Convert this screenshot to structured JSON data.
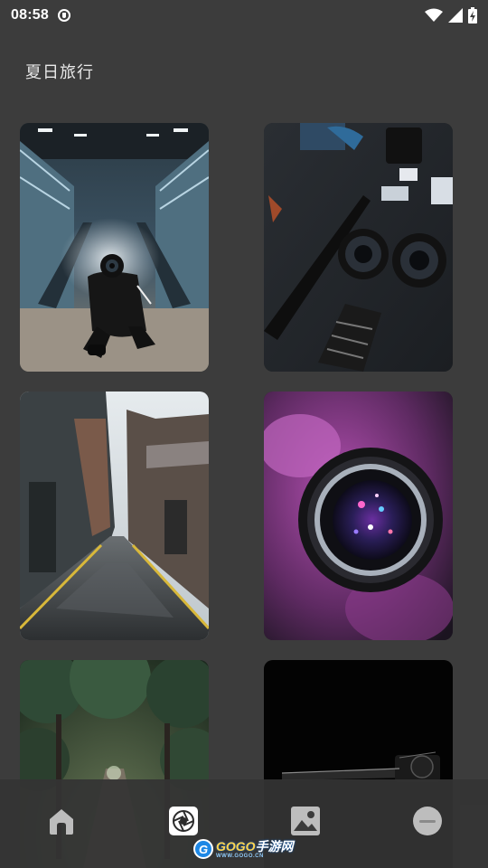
{
  "status_bar": {
    "time": "08:58",
    "icons": [
      "shield-icon",
      "wifi-icon",
      "signal-icon",
      "battery-icon"
    ]
  },
  "album": {
    "title": "夏日旅行"
  },
  "photos": [
    {
      "subject": "escalator-smoke-camera"
    },
    {
      "subject": "camera-lenses-on-table"
    },
    {
      "subject": "wet-city-alley"
    },
    {
      "subject": "purple-lens-closeup"
    },
    {
      "subject": "forest-path"
    },
    {
      "subject": "camera-on-black"
    }
  ],
  "nav": {
    "items": [
      {
        "icon": "home-icon",
        "active": false
      },
      {
        "icon": "aperture-icon",
        "active": true
      },
      {
        "icon": "image-icon",
        "active": false
      },
      {
        "icon": "profile-icon",
        "active": false
      }
    ]
  },
  "watermark": {
    "main_a": "GOGO",
    "main_b": "手游网",
    "sub": "WWW.GOGO.CN"
  },
  "colors": {
    "background": "#3c3c3c",
    "nav_background": "#343434",
    "title_text": "#e8e8e8"
  }
}
